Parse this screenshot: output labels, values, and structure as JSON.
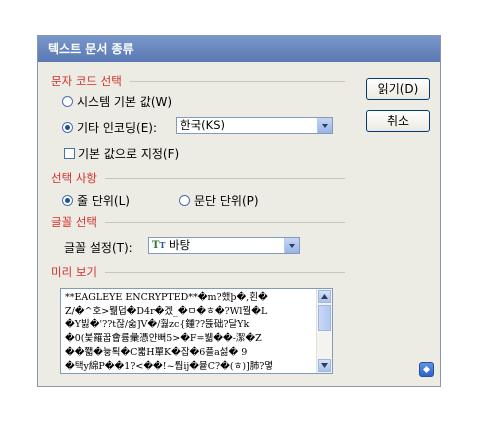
{
  "dialog": {
    "title": "텍스트 문서 종류"
  },
  "encoding_section": {
    "title": "문자 코드 선택",
    "system_default": {
      "label": "시스템 기본 값(W)",
      "selected": false
    },
    "other_encoding": {
      "label": "기타 인코딩(E):",
      "selected": true,
      "value": "한국(KS)"
    },
    "set_default": {
      "label": "기본 값으로 지정(F)",
      "checked": false
    }
  },
  "selection_section": {
    "title": "선택 사항",
    "line_unit": {
      "label": "줄 단위(L)",
      "selected": true
    },
    "paragraph_unit": {
      "label": "문단 단위(P)",
      "selected": false
    }
  },
  "font_section": {
    "title": "글꼴 선택",
    "font_label": "글꼴 설정(T):",
    "font_value": "바탕",
    "font_icon": "truetype-icon"
  },
  "preview_section": {
    "title": "미리 보기",
    "lines": [
      "**EAGLEYE ENCRYPTED**�m?했þ�,횐�",
      "Z/�^호>뭶덥�D4r�겠_�ㅁ�ㅎ�?Wl뭘�L",
      "�Y빓�'??t잖/숣]V�/훯zc{鍾??뜑础?달Yk",
      "�0(붗羅꿉會륨彙憑얀뻐5>�F=뷃��-潔�Z",
      "��쫿�늏퇵�C뿗H單K�잡�6플a섫�      9",
      "�택y綿P��1?<��!~뤕ij�뮽C?�(ㅎ)]肺?몋"
    ]
  },
  "buttons": {
    "read": "읽기(D)",
    "cancel": "취소"
  },
  "colors": {
    "section_title": "#d2302a",
    "titlebar": "#6a88c0"
  }
}
